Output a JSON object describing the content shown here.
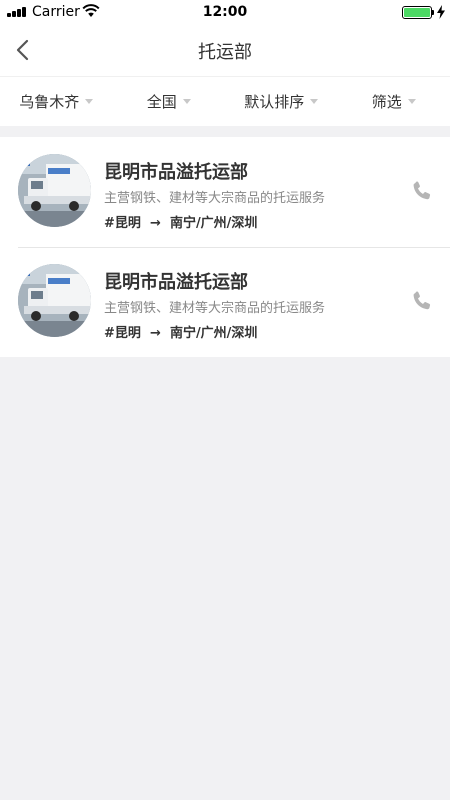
{
  "status_bar": {
    "carrier": "Carrier",
    "time": "12:00",
    "battery_level": 1.0,
    "battery_color": "#4cd964"
  },
  "nav": {
    "title": "托运部",
    "back_icon": "chevron-left-icon"
  },
  "filters": [
    {
      "label": "乌鲁木齐",
      "icon": "caret-down-icon"
    },
    {
      "label": "全国",
      "icon": "caret-down-icon"
    },
    {
      "label": "默认排序",
      "icon": "caret-down-icon"
    },
    {
      "label": "筛选",
      "icon": "caret-down-icon"
    }
  ],
  "companies": [
    {
      "name": "昆明市品溢托运部",
      "description": "主营钢铁、建材等大宗商品的托运服务",
      "origin": "#昆明",
      "arrow": "→",
      "destinations": "南宁/广州/深圳",
      "phone_icon": "phone-icon"
    },
    {
      "name": "昆明市品溢托运部",
      "description": "主营钢铁、建材等大宗商品的托运服务",
      "origin": "#昆明",
      "arrow": "→",
      "destinations": "南宁/广州/深圳",
      "phone_icon": "phone-icon"
    }
  ],
  "colors": {
    "background": "#f1f1f3",
    "text_primary": "#333333",
    "text_secondary": "#888888",
    "caret": "#c8c8c8",
    "phone_icon": "#b5b5b5"
  }
}
